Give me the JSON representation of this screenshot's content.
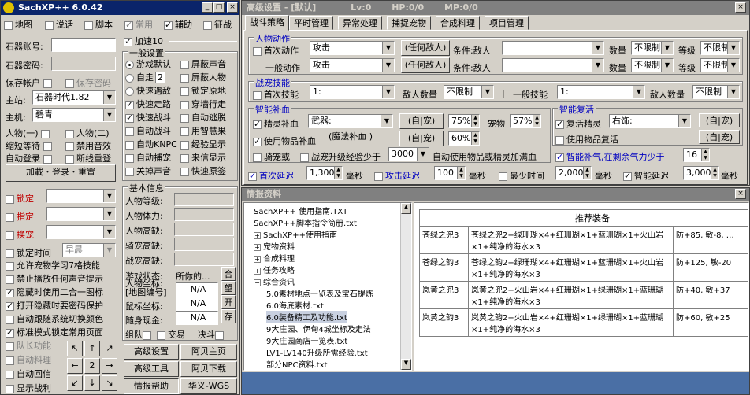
{
  "left": {
    "title": "SachXP++ 6.0.42",
    "row1": [
      "地图",
      "说话",
      "脚本",
      "常用",
      "辅助",
      "征战"
    ],
    "row1_checked": [
      false,
      false,
      false,
      true,
      true,
      false
    ],
    "account_label": "石器账号:",
    "password_label": "石器密码:",
    "save_account": "保存帐户",
    "save_password": "保存密码",
    "server_label": "主站:",
    "server_value": "石器时代1.82",
    "host_label": "主机:",
    "host_value": "碧青",
    "char_label": "人物(一)",
    "char2_label": "人物(二)",
    "wait_label": "缩短等待",
    "mute_label": "禁用音效",
    "autologin_label": "自动登录",
    "reconnect_label": "断线重登",
    "login_button": "加載・登录・重置",
    "add_label": "加速",
    "add_value": "10",
    "general": "一般设置",
    "opts": [
      "游戏默认",
      "屏蔽声音",
      "自走",
      "屏蔽人物",
      "快速遇敌",
      "锁定原地",
      "快速走路",
      "穿墙行走",
      "快速战斗",
      "自动逃脱",
      "自动战斗",
      "用智慧果",
      "自动KNPC",
      "经验显示",
      "自动捕宠",
      "来信显示",
      "关掉声音",
      "快速原签"
    ],
    "opts_checked": [
      true,
      false,
      false,
      false,
      false,
      false,
      true,
      false,
      true,
      false,
      false,
      false,
      false,
      false,
      false,
      false,
      false,
      false
    ],
    "zizou_value": "2",
    "lock_label": "锁定",
    "designate_label": "指定",
    "swap_label": "换宠",
    "locktime_label": "锁定时间",
    "locktime_value": "早晨",
    "extras": [
      "允许宠物学习7格技能",
      "禁止播放任何声音提示",
      "隐藏时使用二合一图标",
      "打开隐藏时要密码保护",
      "自动跟随系统切换颜色",
      "标准模式锁定常用页面"
    ],
    "extras_checked": [
      false,
      false,
      true,
      true,
      false,
      true
    ],
    "team_label": "队长功能",
    "auto_mgmt": "自动料理",
    "auto_reply": "自动回信",
    "show_battle": "显示战利",
    "basic_info": "基本信息",
    "info_labels": [
      "人物等级:",
      "人物体力:",
      "人物高缺:",
      "骑宠高缺:",
      "战宠高缺:"
    ],
    "game_state_label": "游戏状态:",
    "game_state_value": "所你的...",
    "he_btn": "合",
    "coords_label": "人物坐标:",
    "coords_sub": "[地图编号]",
    "coords_value": "N/A",
    "wang_btn": "望",
    "mouse_label": "鼠标坐标:",
    "mouse_value": "N/A",
    "open_btn": "开",
    "gold_label": "随身现金:",
    "gold_value": "N/A",
    "save_btn": "存",
    "group_label": "组队",
    "trade_label": "交易",
    "duel_label": "决斗",
    "btn_adv_settings": "高级设置",
    "btn_abe_home": "阿贝主页",
    "btn_adv_tools": "高级工具",
    "btn_abe_download": "阿贝下载",
    "btn_intel_help": "情报帮助",
    "btn_huayi": "华义-WGS",
    "arrows": [
      "↖",
      "↑",
      "↗",
      "←",
      "2",
      "→",
      "↙",
      "↓",
      "↘"
    ]
  },
  "right": {
    "title": "高级设置 - [默认]",
    "lv": "Lv:0",
    "hp": "HP:0/0",
    "mp": "MP:0/0",
    "tabs": [
      "战斗策略",
      "平时管理",
      "异常处理",
      "捕捉宠物",
      "合成料理",
      "项目管理"
    ],
    "g_action": "人物动作",
    "first_action": "首次动作",
    "general_action": "一般动作",
    "action_value": "攻击",
    "any_enemy": "(任何敌人)",
    "cond_label": "条件:敌人",
    "qty_label": "数量",
    "grade_label": "等级",
    "unlimited": "不限制",
    "g_pet_skill": "战宠技能",
    "first_skill": "首次技能",
    "skill_value": "1:",
    "enemy_qty": "敌人数量",
    "general_skill": "一般技能",
    "g_char_heal": "智能补血",
    "elite_heal": "精灵补血",
    "weapon_label": "武器:",
    "self_pet": "(自|宠)",
    "pct1": "75%",
    "pet_label": "宠物",
    "pct2": "57%",
    "use_item": "使用物品补血",
    "magic_label": "(魔法补血 )",
    "pct3": "60%",
    "ride_label": "骑宠或",
    "pet_exp_label": "战宠升级经验少于",
    "exp_value": "3000",
    "auto_item_label": "自动使用物品或精灵加满血",
    "g_revive": "智能复活",
    "revive_elite": "复活精灵",
    "revive_value": "右饰:",
    "use_revive_item": "使用物品复活",
    "smart_mp": "智能补气,在剩余气力少于",
    "mp_value": "16",
    "first_delay": "首次延迟",
    "fd_value": "1,300",
    "ms": "毫秒",
    "atk_delay": "攻击延迟",
    "ad_value": "100",
    "min_time": "最少时间",
    "mt_value": "2,000",
    "smart_delay": "智能延迟",
    "sd_value": "3,000"
  },
  "intel": {
    "title": "情报资料",
    "tree": [
      "SachXP++ 使用指南.TXT",
      "SachXP++脚本指令简册.txt",
      "SachXP++使用指南",
      "宠物资料",
      "合成料理",
      "任务攻略",
      "综合资讯",
      "5.0素材地点一览表及宝石提炼",
      "6.0海底素材.txt",
      "6.0装备精工及功能.txt",
      "9大庄园、伊甸4城坐标及走法",
      "9大庄园商店一览表.txt",
      "LV1-LV140升级所需经验.txt",
      "部分NPC资料.txt"
    ],
    "table_header": "推荐装备",
    "rows": [
      {
        "name": "苍绿之兜3",
        "recipe": "苍绿之兜2+绿珊瑚×4+红珊瑚×1+蓝珊瑚×1+火山岩×1+纯净的海水×3",
        "attr": "防+85, 敏-8, …"
      },
      {
        "name": "苍绿之韵3",
        "recipe": "苍绿之韵2+绿珊瑚×4+红珊瑚×1+蓝珊瑚×1+火山岩×1+纯净的海水×3",
        "attr": "防+125, 敏-20"
      },
      {
        "name": "岚黄之兜3",
        "recipe": "岚黄之兜2+火山岩×4+红珊瑚×1+绿珊瑚×1+蓝珊瑚×1+纯净的海水×3",
        "attr": "防+40, 敏+37"
      },
      {
        "name": "岚黄之韵3",
        "recipe": "岚黄之韵2+火山岩×4+红珊瑚×1+绿珊瑚×1+蓝珊瑚×1+纯净的海水×3",
        "attr": "防+60, 敏+25"
      }
    ]
  }
}
